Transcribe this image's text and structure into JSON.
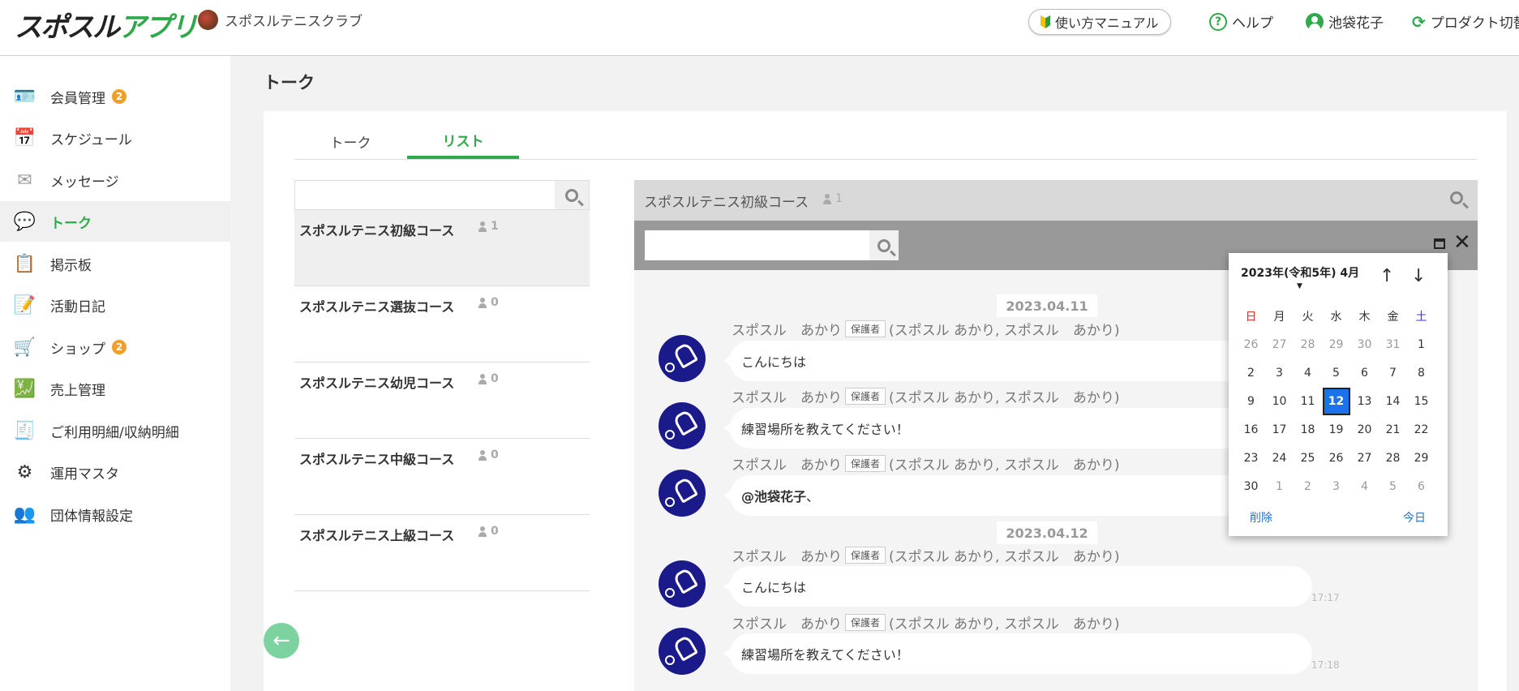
{
  "header": {
    "logo_black": "スポスル",
    "logo_green": "アプリ",
    "club_name": "スポスルテニスクラブ",
    "manual_label": "使い方マニュアル",
    "help_label": "ヘルプ",
    "user_name": "池袋花子",
    "product_switch_label": "プロダクト切替"
  },
  "sidebar": {
    "items": [
      {
        "label": "会員管理",
        "icon": "member-card-icon",
        "badge": "2"
      },
      {
        "label": "スケジュール",
        "icon": "calendar-icon"
      },
      {
        "label": "メッセージ",
        "icon": "envelope-icon"
      },
      {
        "label": "トーク",
        "icon": "chat-bubble-icon",
        "active": true
      },
      {
        "label": "掲示板",
        "icon": "bulletin-board-icon"
      },
      {
        "label": "活動日記",
        "icon": "diary-icon"
      },
      {
        "label": "ショップ",
        "icon": "cart-icon",
        "badge": "2"
      },
      {
        "label": "売上管理",
        "icon": "sales-icon"
      },
      {
        "label": "ご利用明細/収納明細",
        "icon": "statement-icon"
      },
      {
        "label": "運用マスタ",
        "icon": "gears-icon"
      },
      {
        "label": "団体情報設定",
        "icon": "group-settings-icon"
      }
    ]
  },
  "page": {
    "title": "トーク",
    "tabs": [
      "トーク",
      "リスト"
    ],
    "active_tab": "リスト"
  },
  "courses": [
    {
      "name": "スポスルテニス初級コース",
      "count": "1"
    },
    {
      "name": "スポスルテニス選抜コース",
      "count": "0"
    },
    {
      "name": "スポスルテニス幼児コース",
      "count": "0"
    },
    {
      "name": "スポスルテニス中級コース",
      "count": "0"
    },
    {
      "name": "スポスルテニス上級コース",
      "count": "0"
    }
  ],
  "chat": {
    "title": "スポスルテニス初級コース",
    "count": "1",
    "dates": [
      "2023.04.11",
      "2023.04.12"
    ],
    "messages": [
      {
        "sender": "スポスル　あかり",
        "role": "保護者",
        "detail": "(スポスル あかり, スポスル　あかり)",
        "text": "こんにちは",
        "time": ""
      },
      {
        "sender": "スポスル　あかり",
        "role": "保護者",
        "detail": "(スポスル あかり, スポスル　あかり)",
        "text": "練習場所を教えてください！",
        "time": ""
      },
      {
        "sender": "スポスル　あかり",
        "role": "保護者",
        "detail": "(スポスル あかり, スポスル　あかり)",
        "mention": "@池袋花子",
        "text": "、",
        "time": ""
      },
      {
        "sender": "スポスル　あかり",
        "role": "保護者",
        "detail": "(スポスル あかり, スポスル　あかり)",
        "text": "こんにちは",
        "time": "17:17"
      },
      {
        "sender": "スポスル　あかり",
        "role": "保護者",
        "detail": "(スポスル あかり, スポスル　あかり)",
        "text": "練習場所を教えてください！",
        "time": "17:18"
      }
    ]
  },
  "datepicker": {
    "title": "2023年(令和5年) 4月",
    "weekdays": [
      "日",
      "月",
      "火",
      "水",
      "木",
      "金",
      "土"
    ],
    "days": [
      [
        "26",
        "27",
        "28",
        "29",
        "30",
        "31",
        "1"
      ],
      [
        "2",
        "3",
        "4",
        "5",
        "6",
        "7",
        "8"
      ],
      [
        "9",
        "10",
        "11",
        "12",
        "13",
        "14",
        "15"
      ],
      [
        "16",
        "17",
        "18",
        "19",
        "20",
        "21",
        "22"
      ],
      [
        "23",
        "24",
        "25",
        "26",
        "27",
        "28",
        "29"
      ],
      [
        "30",
        "1",
        "2",
        "3",
        "4",
        "5",
        "6"
      ]
    ],
    "selected_day": "12",
    "clear_label": "削除",
    "today_label": "今日"
  },
  "colors": {
    "brand_green": "#2eaa4b",
    "badge_orange": "#f0a028",
    "selected_blue": "#1a73e8",
    "avatar_navy": "#1a1a8a"
  }
}
